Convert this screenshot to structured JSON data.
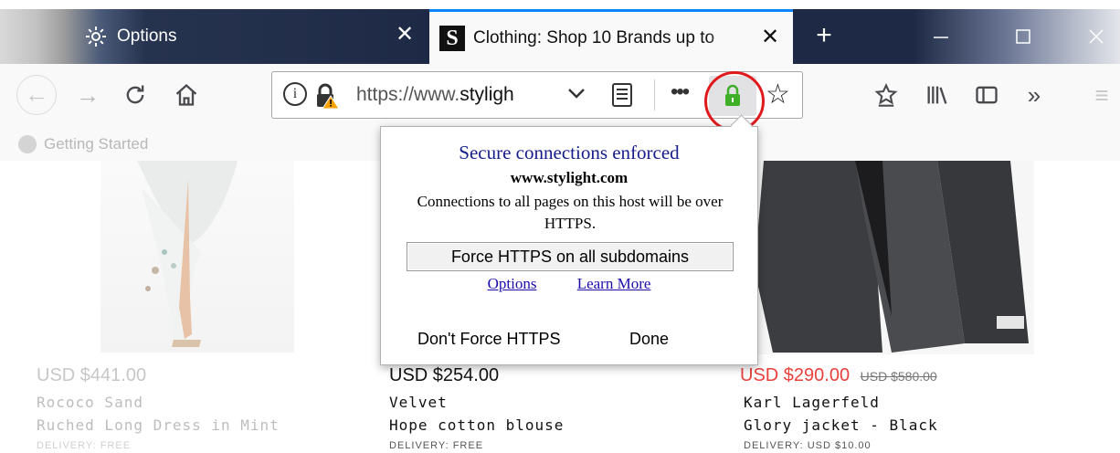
{
  "tabs": [
    {
      "label": "Options",
      "icon": "gear-icon",
      "active": false
    },
    {
      "label": "Clothing: Shop 10 Brands up to",
      "icon": "stylight-favicon",
      "active": true
    }
  ],
  "navbar": {
    "url_scheme": "https://www.",
    "url_host": "styligh"
  },
  "bookmarks": [
    {
      "label": "Getting Started"
    }
  ],
  "products": [
    {
      "price": "USD $441.00",
      "old_price": "",
      "name_line1": "Rococo Sand",
      "name_line2": "Ruched Long Dress in Mint",
      "delivery": "DELIVERY: FREE"
    },
    {
      "price": "USD $254.00",
      "old_price": "",
      "name_line1": "Velvet",
      "name_line2": "Hope cotton blouse",
      "delivery": "DELIVERY: FREE"
    },
    {
      "price": "USD $290.00",
      "old_price": "USD $580.00",
      "name_line1": "Karl Lagerfeld",
      "name_line2": "Glory jacket - Black",
      "delivery": "DELIVERY: USD $10.00"
    }
  ],
  "popup": {
    "title": "Secure connections enforced",
    "host": "www.stylight.com",
    "description": "Connections to all pages on this host will be over HTTPS.",
    "force_button": "Force HTTPS on all subdomains",
    "options_link": "Options",
    "learn_more_link": "Learn More",
    "dont_force": "Don't Force HTTPS",
    "done": "Done"
  },
  "colors": {
    "accent": "#0a84ff",
    "highlight_circle": "#e0191c",
    "extension_lock": "#3fae29",
    "sale_price": "#e8413c"
  }
}
